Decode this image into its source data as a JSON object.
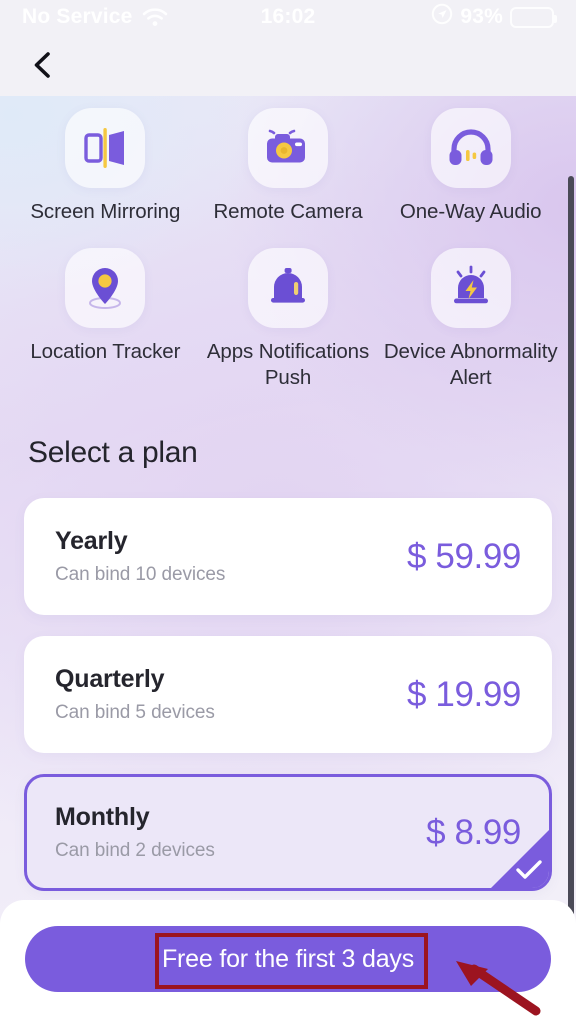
{
  "status_bar": {
    "carrier": "No Service",
    "time": "16:02",
    "battery_percent": "93%",
    "wifi_icon": "wifi-icon",
    "location_icon": "location-arrow-icon",
    "battery_icon": "battery-icon"
  },
  "nav": {
    "back_icon": "back-chevron-icon"
  },
  "features": [
    {
      "label": "Screen Mirroring",
      "icon": "screen-mirroring-icon"
    },
    {
      "label": "Remote Camera",
      "icon": "remote-camera-icon"
    },
    {
      "label": "One-Way Audio",
      "icon": "one-way-audio-icon"
    },
    {
      "label": "Location Tracker",
      "icon": "location-tracker-icon"
    },
    {
      "label": "Apps Notifications Push",
      "icon": "apps-notifications-icon"
    },
    {
      "label": "Device Abnormality Alert",
      "icon": "device-abnormality-icon"
    }
  ],
  "section": {
    "title": "Select a plan"
  },
  "plans": [
    {
      "name": "Yearly",
      "sub": "Can bind 10 devices",
      "price": "$ 59.99",
      "selected": false
    },
    {
      "name": "Quarterly",
      "sub": "Can bind 5 devices",
      "price": "$ 19.99",
      "selected": false
    },
    {
      "name": "Monthly",
      "sub": "Can bind 2 devices",
      "price": "$ 8.99",
      "selected": true
    }
  ],
  "cta": {
    "label": "Free for the first 3 days"
  },
  "colors": {
    "accent_purple": "#7a5cdd",
    "accent_yellow": "#f5c842",
    "annotation_red": "#9c1420",
    "card_white": "#ffffff",
    "selected_card_bg": "#ece7f8",
    "muted_text": "#9a9aa6"
  }
}
